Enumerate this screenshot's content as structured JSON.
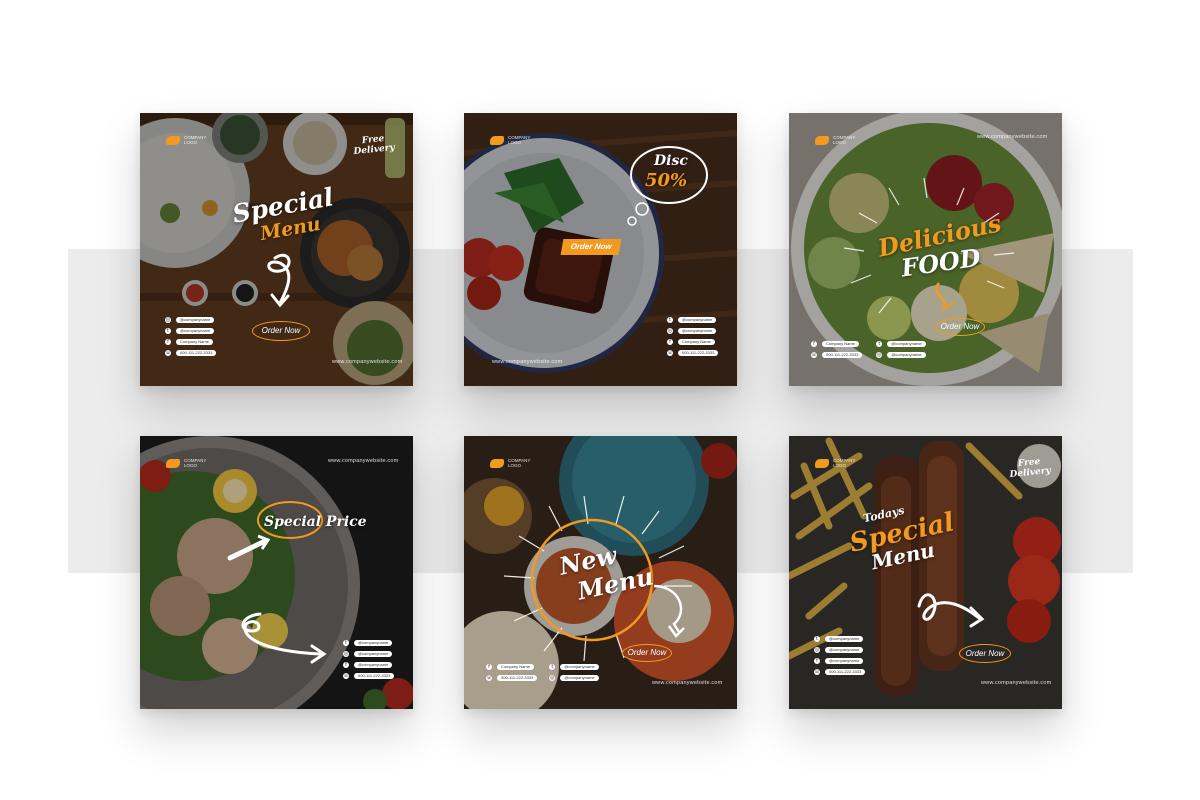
{
  "cards": [
    {
      "id": "card-1",
      "logo": "COMPANY\nLOGO",
      "free_delivery": "Free\nDelivery",
      "headline_1": "Special",
      "headline_2": "Menu",
      "order_button": "Order Now",
      "website": "www.companywebsite.com",
      "contacts": [
        "@companyname",
        "@companyname",
        "Company Name",
        "000-111-222-3333"
      ]
    },
    {
      "id": "card-2",
      "logo": "COMPANY\nLOGO",
      "disc_label": "Disc",
      "disc_value": "50%",
      "order_button": "Order Now",
      "website": "www.companywebsite.com",
      "contacts": [
        "@companyname",
        "@companyname",
        "Company Name",
        "000-111-222-3333"
      ]
    },
    {
      "id": "card-3",
      "logo": "COMPANY\nLOGO",
      "headline_1": "Delicious",
      "headline_2": "FOOD",
      "order_button": "Order Now",
      "website": "www.companywebsite.com",
      "contacts": [
        "Company Name",
        "@companyname",
        "000-111-222-3333",
        "@companyname"
      ]
    },
    {
      "id": "card-4",
      "logo": "COMPANY\nLOGO",
      "headline": "Special Price",
      "website": "www.companywebsite.com",
      "contacts": [
        "@companyname",
        "@companyname",
        "@companyname",
        "000-111-222-3333"
      ]
    },
    {
      "id": "card-5",
      "logo": "COMPANY\nLOGO",
      "headline_1": "New",
      "headline_2": "Menu",
      "order_button": "Order Now",
      "website": "www.companywebsite.com",
      "contacts": [
        "Company Name",
        "@companyname",
        "000-111-222-3333",
        "@companyname"
      ]
    },
    {
      "id": "card-6",
      "logo": "COMPANY\nLOGO",
      "free_delivery": "Free\nDelivery",
      "headline_0": "Todays",
      "headline_1": "Special",
      "headline_2": "Menu",
      "order_button": "Order Now",
      "website": "www.companywebsite.com",
      "contacts": [
        "@companyname",
        "@companyname",
        "@companyname",
        "000-111-222-3333"
      ]
    }
  ],
  "colors": {
    "accent": "#f29a1f",
    "band": "#ececec",
    "background": "#ffffff"
  },
  "icons": [
    "instagram-icon",
    "twitter-icon",
    "facebook-icon",
    "whatsapp-icon"
  ]
}
